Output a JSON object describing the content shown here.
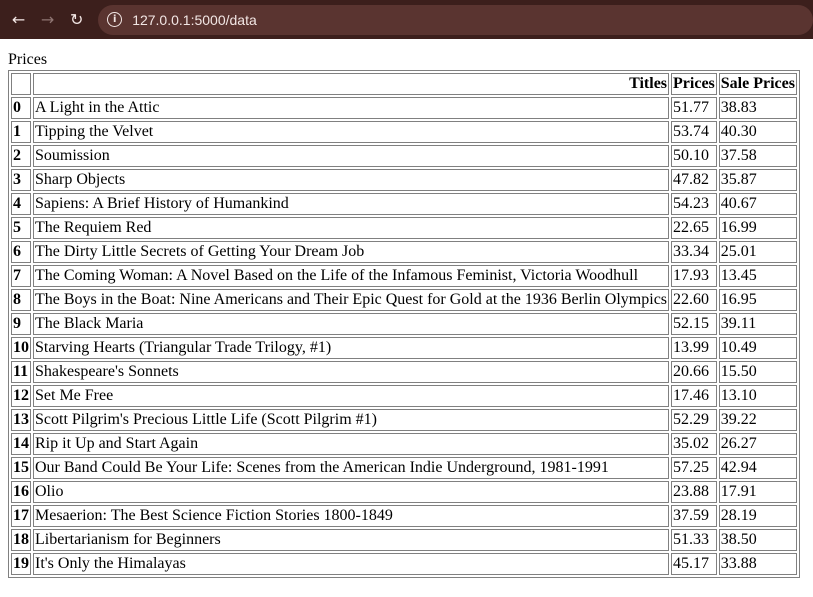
{
  "browser": {
    "url": "127.0.0.1:5000/data"
  },
  "page": {
    "caption": "Prices"
  },
  "table": {
    "columns": [
      "",
      "Titles",
      "Prices",
      "Sale Prices"
    ],
    "rows": [
      {
        "index": "0",
        "title": "A Light in the Attic",
        "price": "51.77",
        "sale": "38.83"
      },
      {
        "index": "1",
        "title": "Tipping the Velvet",
        "price": "53.74",
        "sale": "40.30"
      },
      {
        "index": "2",
        "title": "Soumission",
        "price": "50.10",
        "sale": "37.58"
      },
      {
        "index": "3",
        "title": "Sharp Objects",
        "price": "47.82",
        "sale": "35.87"
      },
      {
        "index": "4",
        "title": "Sapiens: A Brief History of Humankind",
        "price": "54.23",
        "sale": "40.67"
      },
      {
        "index": "5",
        "title": "The Requiem Red",
        "price": "22.65",
        "sale": "16.99"
      },
      {
        "index": "6",
        "title": "The Dirty Little Secrets of Getting Your Dream Job",
        "price": "33.34",
        "sale": "25.01"
      },
      {
        "index": "7",
        "title": "The Coming Woman: A Novel Based on the Life of the Infamous Feminist, Victoria Woodhull",
        "price": "17.93",
        "sale": "13.45"
      },
      {
        "index": "8",
        "title": "The Boys in the Boat: Nine Americans and Their Epic Quest for Gold at the 1936 Berlin Olympics",
        "price": "22.60",
        "sale": "16.95"
      },
      {
        "index": "9",
        "title": "The Black Maria",
        "price": "52.15",
        "sale": "39.11"
      },
      {
        "index": "10",
        "title": "Starving Hearts (Triangular Trade Trilogy, #1)",
        "price": "13.99",
        "sale": "10.49"
      },
      {
        "index": "11",
        "title": "Shakespeare's Sonnets",
        "price": "20.66",
        "sale": "15.50"
      },
      {
        "index": "12",
        "title": "Set Me Free",
        "price": "17.46",
        "sale": "13.10"
      },
      {
        "index": "13",
        "title": "Scott Pilgrim's Precious Little Life (Scott Pilgrim #1)",
        "price": "52.29",
        "sale": "39.22"
      },
      {
        "index": "14",
        "title": "Rip it Up and Start Again",
        "price": "35.02",
        "sale": "26.27"
      },
      {
        "index": "15",
        "title": "Our Band Could Be Your Life: Scenes from the American Indie Underground, 1981-1991",
        "price": "57.25",
        "sale": "42.94"
      },
      {
        "index": "16",
        "title": "Olio",
        "price": "23.88",
        "sale": "17.91"
      },
      {
        "index": "17",
        "title": "Mesaerion: The Best Science Fiction Stories 1800-1849",
        "price": "37.59",
        "sale": "28.19"
      },
      {
        "index": "18",
        "title": "Libertarianism for Beginners",
        "price": "51.33",
        "sale": "38.50"
      },
      {
        "index": "19",
        "title": "It's Only the Himalayas",
        "price": "45.17",
        "sale": "33.88"
      }
    ]
  }
}
